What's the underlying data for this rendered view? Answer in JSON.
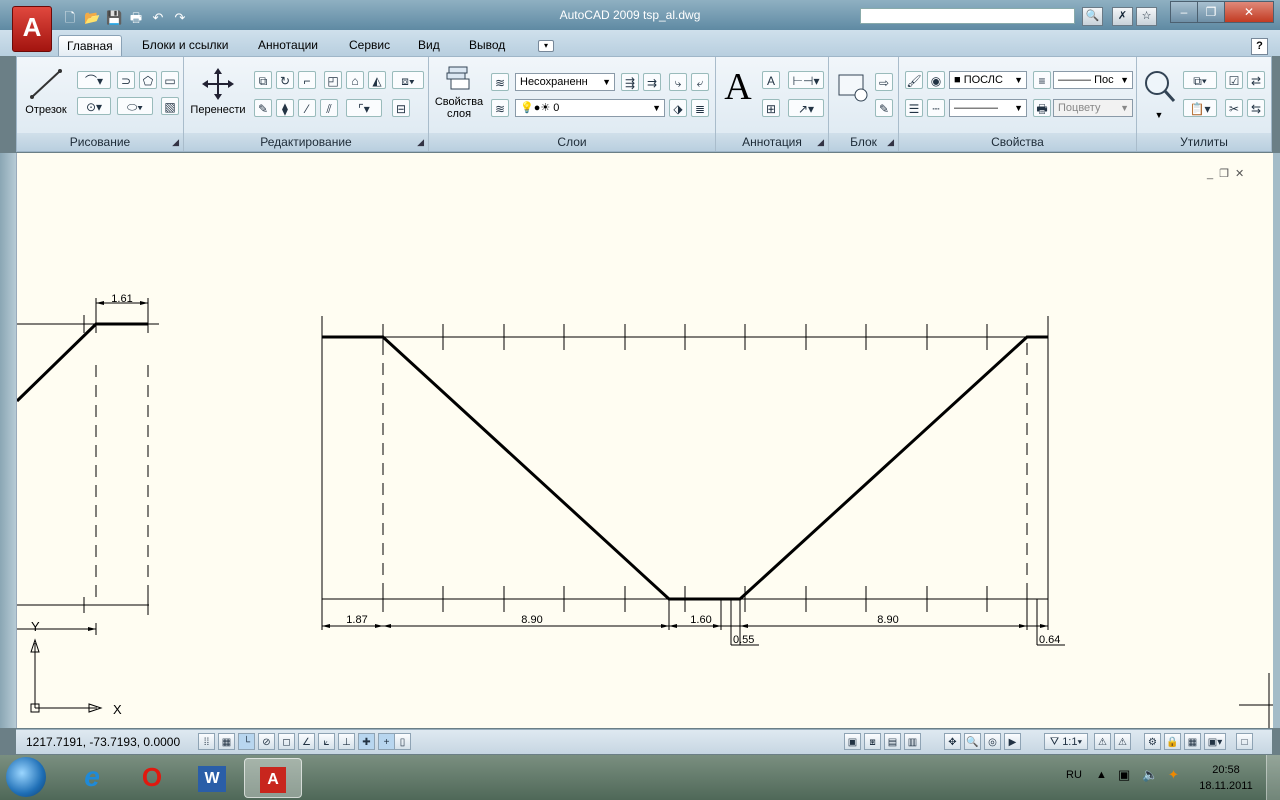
{
  "window": {
    "title": "AutoCAD 2009 tsp_al.dwg",
    "app_logo": "A",
    "search_placeholder": "",
    "minimize_label": "–",
    "restore_label": "❐",
    "close_label": "✕"
  },
  "quick_access": [
    "new-icon",
    "open-icon",
    "save-icon",
    "print-icon",
    "undo-icon",
    "redo-icon"
  ],
  "tabs": [
    {
      "label": "Главная",
      "active": true
    },
    {
      "label": "Блоки и ссылки"
    },
    {
      "label": "Аннотации"
    },
    {
      "label": "Сервис"
    },
    {
      "label": "Вид"
    },
    {
      "label": "Вывод"
    }
  ],
  "help_label": "?",
  "panels": {
    "draw": {
      "title": "Рисование",
      "line_label": "Отрезок"
    },
    "modify": {
      "title": "Редактирование",
      "move_label": "Перенести"
    },
    "layers": {
      "title": "Слои",
      "props_label_1": "Свойства",
      "props_label_2": "слоя",
      "layer_state": "Несохраненн",
      "current_layer": "0"
    },
    "annotation": {
      "title": "Аннотация",
      "text_icon": "A"
    },
    "block": {
      "title": "Блок"
    },
    "properties": {
      "title": "Свойства",
      "color": "ПОСЛС",
      "lineweight": "Пос",
      "plotstyle": "Поцвету"
    },
    "utilities": {
      "title": "Утилиты"
    }
  },
  "drawing": {
    "top_dim_label": "1.61",
    "dim_labels": [
      "1.87",
      "8.90",
      "1.60",
      "8.90"
    ],
    "small_dims": [
      "0.55",
      "0.64"
    ],
    "ucs_y": "Y",
    "ucs_x": "X",
    "viewport_controls": [
      "_",
      "❐",
      "✕"
    ]
  },
  "status": {
    "coords": "1217.7191, -73.7193, 0.0000",
    "scale": "1:1"
  },
  "taskbar": {
    "language": "RU",
    "time": "20:58",
    "date": "18.11.2011"
  }
}
